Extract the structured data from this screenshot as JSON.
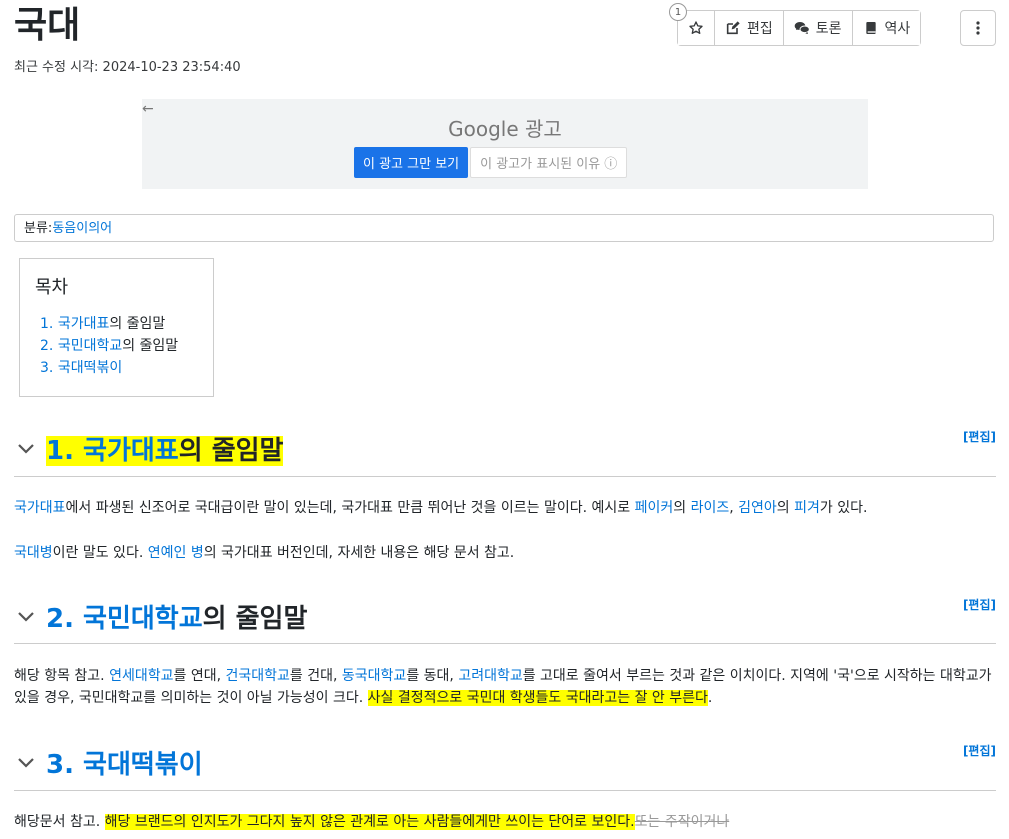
{
  "page": {
    "title": "국대",
    "last_modified_label": "최근 수정 시각:",
    "last_modified": "2024-10-23 23:54:40"
  },
  "toolbar": {
    "star_count": "1",
    "edit": "편집",
    "discuss": "토론",
    "history": "역사"
  },
  "ad": {
    "back": "←",
    "logo_google": "Google",
    "logo_text": "광고",
    "stop": "이 광고 그만 보기",
    "why": "이 광고가 표시된 이유 ⓘ"
  },
  "category": {
    "label": "분류:",
    "value": "동음이의어"
  },
  "toc": {
    "title": "목차",
    "items": [
      {
        "num": "1.",
        "link": "국가대표",
        "rest": "의 줄임말"
      },
      {
        "num": "2.",
        "link": "국민대학교",
        "rest": "의 줄임말"
      },
      {
        "num": "3.",
        "link": "국대떡볶이",
        "rest": ""
      }
    ]
  },
  "sections": [
    {
      "num": "1.",
      "link": "국가대표",
      "rest": "의 줄임말",
      "edit": "[편집]"
    },
    {
      "num": "2.",
      "link": "국민대학교",
      "rest": "의 줄임말",
      "edit": "[편집]"
    },
    {
      "num": "3.",
      "link": "국대떡볶이",
      "rest": "",
      "edit": "[편집]"
    }
  ],
  "s1": {
    "p1": {
      "l1": "국가대표",
      "t1": "에서 파생된 신조어로 국대급이란 말이 있는데, 국가대표 만큼 뛰어난 것을 이르는 말이다. 예시로 ",
      "l2": "페이커",
      "t2": "의 ",
      "l3": "라이즈",
      "t3": ", ",
      "l4": "김연아",
      "t4": "의 ",
      "l5": "피겨",
      "t5": "가 있다."
    },
    "p2": {
      "l1": "국대병",
      "t1": "이란 말도 있다. ",
      "l2": "연예인 병",
      "t2": "의 국가대표 버전인데, 자세한 내용은 해당 문서 참고."
    }
  },
  "s2": {
    "p1": {
      "t0": "해당 항목 참고. ",
      "l1": "연세대학교",
      "t1": "를 연대, ",
      "l2": "건국대학교",
      "t2": "를 건대, ",
      "l3": "동국대학교",
      "t3": "를 동대, ",
      "l4": "고려대학교",
      "t4": "를 고대로 줄여서 부르는 것과 같은 이치이다. 지역에 '국'으로 시작하는 대학교가 있을 경우, 국민대학교를 의미하는 것이 아닐 가능성이 크다. ",
      "hl": "사실 결정적으로 국민대 학생들도 국대라고는 잘 안 부른다",
      "end": "."
    }
  },
  "s3": {
    "p1": {
      "t0": "해당문서 참고. ",
      "hl": "해당 브랜드의 인지도가 그다지 높지 않은 관계로 아는 사람들에게만 쓰이는 단어로 보인다.",
      "strike": "또는 주작이거나"
    }
  }
}
